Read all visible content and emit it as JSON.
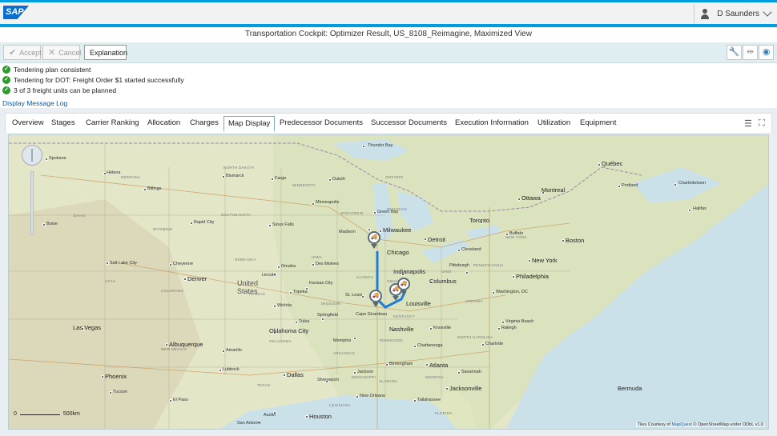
{
  "shell": {
    "logo": "SAP",
    "user_name": "D Saunders"
  },
  "page": {
    "title": "Transportation Cockpit: Optimizer Result, US_8108_Reimagine, Maximized View"
  },
  "toolbar": {
    "accept_label": "Accept",
    "cancel_label": "Cancel",
    "explanation_label": "Explanation"
  },
  "messages": {
    "items": [
      "Tendering plan consistent",
      "Tendering for DOT: Freight Order $1 started successfully",
      "3 of 3 freight units can be planned"
    ],
    "log_link": "Display Message Log"
  },
  "tabs": [
    "Overview",
    "Stages",
    "Carrier Ranking",
    "Allocation",
    "Charges",
    "Map Display",
    "Predecessor Documents",
    "Successor Documents",
    "Execution Information",
    "Utilization",
    "Equipment"
  ],
  "selected_tab": "Map Display",
  "map": {
    "cities": {
      "thunder_bay": "Thunder Bay",
      "spokane": "Spokane",
      "helena": "Helena",
      "bismarck": "Bismarck",
      "billings": "Billings",
      "fargo": "Fargo",
      "minneapolis": "Minneapolis",
      "duluth": "Duluth",
      "sioux_falls": "Sioux Falls",
      "rapid_city": "Rapid City",
      "boise": "Boise",
      "salt_lake_city": "Salt Lake City",
      "denver": "Denver",
      "omaha": "Omaha",
      "des_moines": "Des Moines",
      "milwaukee": "Milwaukee",
      "chicago": "Chicago",
      "detroit": "Detroit",
      "toronto": "Toronto",
      "ottawa": "Ottawa",
      "montreal": "Montreal",
      "quebec": "Québec",
      "boston": "Boston",
      "new_york": "New York",
      "philadelphia": "Philadelphia",
      "washington": "Washington, DC",
      "pittsburgh": "Pittsburgh",
      "columbus": "Columbus",
      "indianapolis": "Indianapolis",
      "st_louis": "St. Louis",
      "louisville": "Louisville",
      "nashville": "Nashville",
      "atlanta": "Atlanta",
      "jacksonville": "Jacksonville",
      "charlotte": "Charlotte",
      "virginia_beach": "Virginia Beach",
      "raleigh": "Raleigh",
      "memphis": "Memphis",
      "new_orleans": "New Orleans",
      "houston": "Houston",
      "san_antonio": "San Antonio",
      "austin": "Austin",
      "dallas": "Dallas",
      "oklahoma_city": "Oklahoma City",
      "tulsa": "Tulsa",
      "wichita": "Wichita",
      "kansas_city": "Kansas City",
      "albuquerque": "Albuquerque",
      "phoenix": "Phoenix",
      "tucson": "Tucson",
      "el_paso": "El Paso",
      "las_vegas": "Las Vegas",
      "lubbock": "Lubbock",
      "amarillo": "Amarillo",
      "springfield": "Springfield",
      "birmingham": "Birmingham",
      "tallahassee": "Tallahassee",
      "shreveport": "Shreveport",
      "jackson": "Jackson",
      "charlottetown": "Charlottetown",
      "halifax": "Halifax",
      "portland": "Portland",
      "cape_girardeau": "Cape Girardeau",
      "knoxville": "Knoxville",
      "chattanooga": "Chattanooga",
      "cleveland": "Cleveland",
      "buffalo": "Buffalo",
      "cheyenne": "Cheyenne",
      "lincoln": "Lincoln",
      "madison": "Madison",
      "green_bay": "Green Bay",
      "topeka": "Topeka",
      "savannah": "Savannah"
    },
    "states": {
      "north_dakota": "NORTH DAKOTA",
      "south_dakota": "SOUTHDAKOTA",
      "nebraska": "NEBRASKA",
      "kansas": "KANSAS",
      "minnesota": "MINNESOTA",
      "wisconsin": "WISCONSIN",
      "iowa": "IOWA",
      "idaho": "IDAHO",
      "montana": "MONTANA",
      "wyoming": "WYOMING",
      "utah": "UTAH",
      "colorado": "COLORADO",
      "new_mexico": "NEW MEXICO",
      "texas": "TEXAS",
      "oklahoma": "OKLAHOMA",
      "arkansas": "ARKANSAS",
      "missouri": "MISSOURI",
      "illinois": "ILLINOIS",
      "indiana": "INDIANA",
      "ohio": "OHIO",
      "kentucky": "KENTUCKY",
      "tennessee": "TENNESSEE",
      "mississippi": "MISSISSIPPI",
      "alabama": "ALABAMA",
      "georgia": "GEORGIA",
      "louisiana": "LOUISIANA",
      "florida": "FLORIDA",
      "michigan": "MICHIGAN",
      "new_york_state": "NEW YORK",
      "pennsylvania": "PENNSYLVANIA",
      "virginia": "VIRGINIA",
      "north_carolina": "NORTH CAROLINA",
      "ontario": "ONTARIO"
    },
    "country_label": "United States",
    "bermuda": "Bermuda",
    "scale_zero": "0",
    "scale_label": "500km",
    "attribution_prefix": "Tiles Courtesy of",
    "attribution_link": "MapQuest",
    "attribution_suffix": "© OpenStreetMap under ODbL v1.0"
  },
  "colors": {
    "accent": "#009de0",
    "route": "#1e7fd6",
    "ok": "#2b9b2b"
  }
}
